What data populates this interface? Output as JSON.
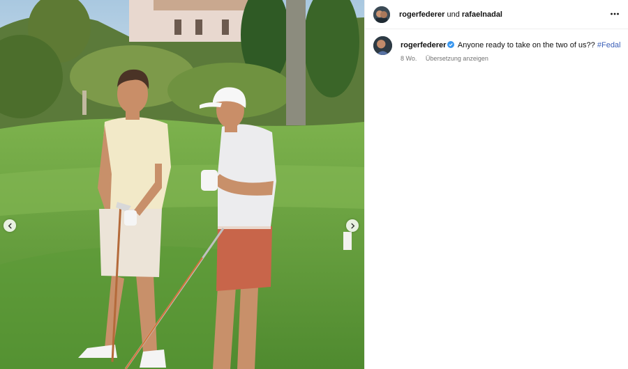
{
  "post": {
    "author": "rogerfederer",
    "conjunction": "und",
    "coauthor": "rafaelnadal",
    "caption_text": "Anyone ready to take on the two of us??",
    "hashtag": "#Fedal",
    "age": "8 Wo.",
    "translate_label": "Übersetzung anzeigen"
  },
  "icons": {
    "more": "more-horizontal-icon",
    "verified": "verified-badge-icon",
    "prev": "chevron-left-icon",
    "next": "chevron-right-icon"
  },
  "colors": {
    "hashtag": "#3b5fb8",
    "verified": "#3897f0",
    "meta": "#737373"
  }
}
